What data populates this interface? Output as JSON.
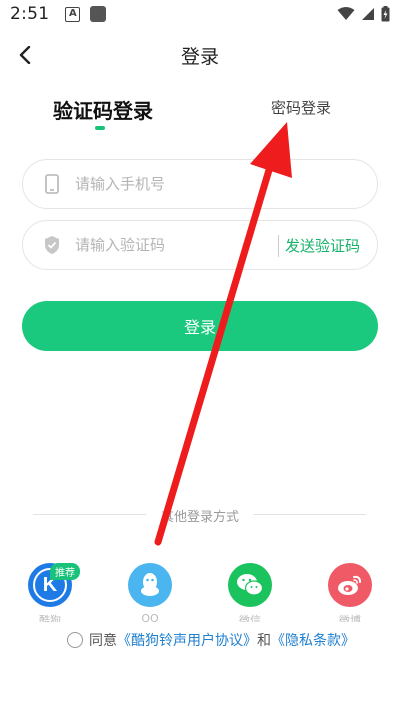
{
  "status_bar": {
    "time": "2:51",
    "notif_letter": "A",
    "icons": [
      "notification-a-icon",
      "notification-square-icon",
      "wifi-icon",
      "signal-icon",
      "battery-charging-icon"
    ]
  },
  "header": {
    "title": "登录"
  },
  "tabs": {
    "sms_label": "验证码登录",
    "password_label": "密码登录"
  },
  "form": {
    "phone_placeholder": "请输入手机号",
    "code_placeholder": "请输入验证码",
    "send_code_label": "发送验证码",
    "login_label": "登录"
  },
  "other_login": {
    "title": "其他登录方式",
    "recommend_badge": "推荐",
    "methods": [
      {
        "icon": "kugou-icon",
        "label": "酷狗"
      },
      {
        "icon": "qq-icon",
        "label": "QQ"
      },
      {
        "icon": "wechat-icon",
        "label": "微信"
      },
      {
        "icon": "weibo-icon",
        "label": "微博"
      }
    ]
  },
  "agreement": {
    "prefix": "同意",
    "user_agreement": "《酷狗铃声用户协议》",
    "and": "和",
    "privacy": "《隐私条款》"
  },
  "colors": {
    "accent": "#1ac97e",
    "link": "#1f7fd0",
    "arrow": "#ee1c1c"
  }
}
